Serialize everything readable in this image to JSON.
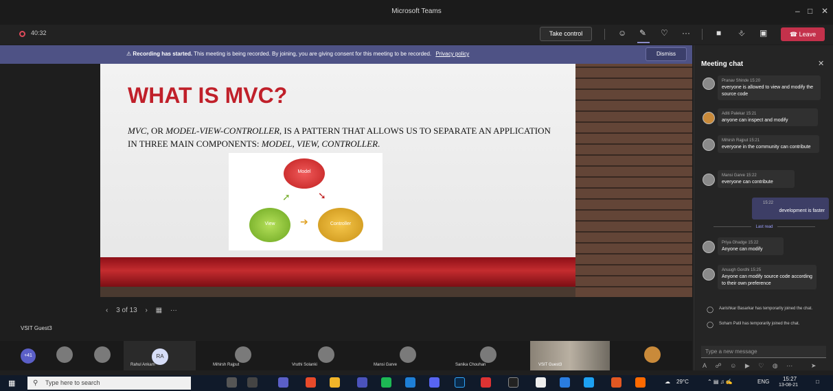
{
  "window": {
    "title": "Microsoft Teams",
    "minimize": "–",
    "maximize": "□",
    "close": "✕"
  },
  "toolbar": {
    "timer": "40:32",
    "take_control": "Take control",
    "leave": "Leave",
    "more": "···"
  },
  "banner": {
    "heading": "Recording has started.",
    "message": "This meeting is being recorded. By joining, you are giving consent for this meeting to be recorded.",
    "policy_link": "Privacy policy",
    "dismiss": "Dismiss"
  },
  "slide": {
    "title": "WHAT IS MVC?",
    "body_1": "MVC",
    "body_2": ", or ",
    "body_3": "Model-View-Controller",
    "body_4": ", is a pattern that allows us to separate an application in three main components: ",
    "body_5": "Model, View, Controller",
    "body_6": ".",
    "diagram": {
      "model": "Model",
      "view": "View",
      "controller": "Controller"
    }
  },
  "slide_nav": {
    "prev": "‹",
    "counter": "3 of 13",
    "next": "›",
    "more": "···"
  },
  "presenter": "VSIT Guest3",
  "chat": {
    "title": "Meeting chat",
    "close": "✕",
    "messages": [
      {
        "name": "Pranav Shinde",
        "time": "15:20",
        "text": "everyone is allowed to view and modify the source code"
      },
      {
        "name": "Aditi Palekar",
        "time": "15:21",
        "text": "anyone can inspect and modify"
      },
      {
        "name": "Mihirsh Rajput",
        "time": "15:21",
        "text": "everyone in the community can contribute"
      },
      {
        "name": "Mansi Garve",
        "time": "15:22",
        "text": "everyone can contribute"
      }
    ],
    "mine": {
      "time": "15:22",
      "text": "development is faster"
    },
    "last_read": "Last read",
    "after": [
      {
        "name": "Priya Ghadge",
        "time": "15:22",
        "text": "Anyone can modify"
      },
      {
        "name": "Anuugh Gordhi",
        "time": "15:25",
        "text": "Anyone can modify source code according to their own preference"
      }
    ],
    "system": [
      "Aarishkar Basarkar has temporarily joined the chat.",
      "Soham Patil has temporarily joined the chat."
    ],
    "compose_placeholder": "Type a new message"
  },
  "participants": {
    "more": "+41",
    "ra_initials": "RA",
    "names": [
      "Rahul Ankam",
      "Mihirsh Rajput",
      "Vruthi Solanki",
      "Mansi Garve",
      "Sanika Chouhan",
      "VSIT Guest3"
    ]
  },
  "taskbar": {
    "search": "Type here to search",
    "temp": "29°C",
    "lang": "ENG",
    "time": "15:27",
    "date": "13-08-21"
  },
  "colors": {
    "accent": "#5b5fc7",
    "leave": "#c4314b",
    "slide_red": "#c0202a",
    "banner": "#4e5285"
  }
}
